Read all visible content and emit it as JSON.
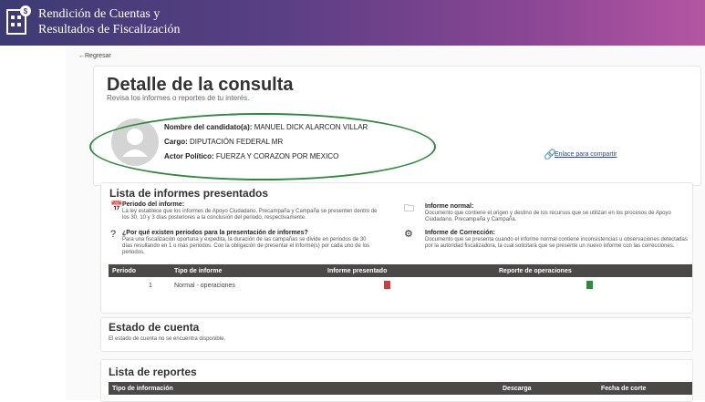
{
  "app": {
    "title_line1": "Rendición de Cuentas y",
    "title_line2": "Resultados de Fiscalización"
  },
  "nav": {
    "back_label": "←Regresar"
  },
  "header": {
    "title": "Detalle de la consulta",
    "subtitle": "Revisa los informes o reportes de tu interés."
  },
  "profile": {
    "name_label": "Nombre del candidato(a):",
    "name_value": "MANUEL DICK ALARCON VILLAR",
    "cargo_label": "Cargo:",
    "cargo_value": "DIPUTACIÓN FEDERAL MR",
    "actor_label": "Actor Político:",
    "actor_value": "FUERZA Y CORAZON POR MEXICO",
    "share_label": "Enlace para compartir"
  },
  "informes": {
    "title": "Lista de informes presentados",
    "periodo_title": "Periodo del informe:",
    "periodo_text": "La ley establece que los informes de Apoyo Ciudadano, Precampaña y Campaña se presenten dentro de los 30, 10 y 3 días posteriores a la conclusión del periodo, respectivamente.",
    "normal_title": "Informe normal:",
    "normal_text": "Documento que contiene el origen y destino de los recursos que se utilizan en los procesos de Apoyo Ciudadano, Precampaña y Campaña.",
    "porque_title": "¿Por qué existen periodos para la presentación de informes?",
    "porque_text": "Para una fiscalización oportuna y expedita, la duración de las campañas se divide en periodos de 30 días resultando en 1 o más periodos. Con la obligación de presentar el informe(s) por cada uno de los periodos.",
    "correccion_title": "Informe de Corrección:",
    "correccion_text": "Documento que se presenta cuando el informe normal contiene inconsistencias u observaciones detectadas por la autoridad fiscalizadora, la cual solicitará que se presente un nuevo informe con las correcciones.",
    "columns": [
      "Periodo",
      "Tipo de informe",
      "Informe presentado",
      "Reporte de operaciones"
    ],
    "rows": [
      {
        "periodo": "1",
        "tipo": "Normal - operaciones"
      }
    ],
    "pdf_color": "#d33b3b",
    "xls_color": "#2e8b3e"
  },
  "estado": {
    "title": "Estado de cuenta",
    "text": "El estado de cuenta no se encuentra disponible."
  },
  "reportes": {
    "title": "Lista de reportes",
    "columns": [
      "Tipo de información",
      "Descarga",
      "Fecha de corte"
    ]
  }
}
